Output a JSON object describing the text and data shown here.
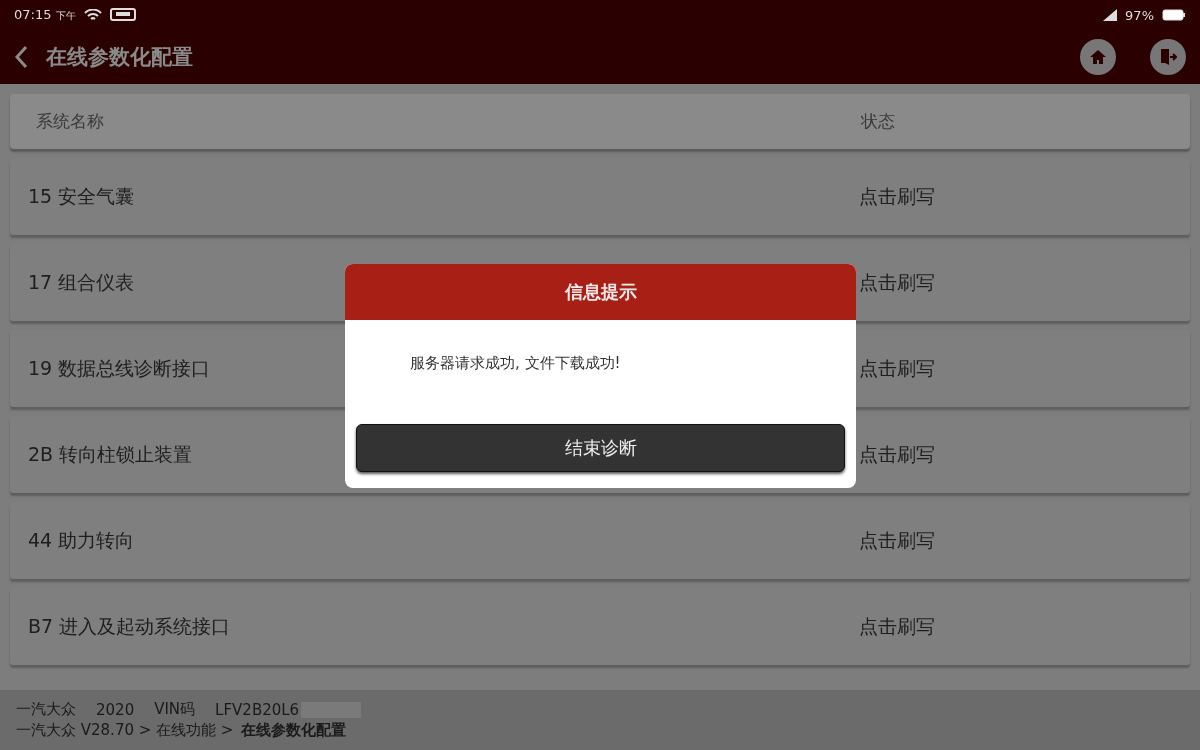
{
  "status_bar": {
    "time": "07:15",
    "period": "下午",
    "battery": "97%"
  },
  "header": {
    "title": "在线参数化配置"
  },
  "table": {
    "columns": [
      "系统名称",
      "状态"
    ],
    "rows": [
      {
        "name": "15 安全气囊",
        "status": "点击刷写"
      },
      {
        "name": "17 组合仪表",
        "status": "点击刷写"
      },
      {
        "name": "19 数据总线诊断接口",
        "status": "点击刷写"
      },
      {
        "name": "2B 转向柱锁止装置",
        "status": "点击刷写"
      },
      {
        "name": "44 助力转向",
        "status": "点击刷写"
      },
      {
        "name": "B7 进入及起动系统接口",
        "status": "点击刷写"
      }
    ]
  },
  "footer": {
    "make": "一汽大众",
    "year": "2020",
    "vin_label": "VIN码",
    "vin": "LFV2B20L6",
    "path": "一汽大众 V28.70 > 在线功能 >",
    "current": "在线参数化配置"
  },
  "dialog": {
    "title": "信息提示",
    "message": "服务器请求成功, 文件下载成功!",
    "button": "结束诊断"
  }
}
